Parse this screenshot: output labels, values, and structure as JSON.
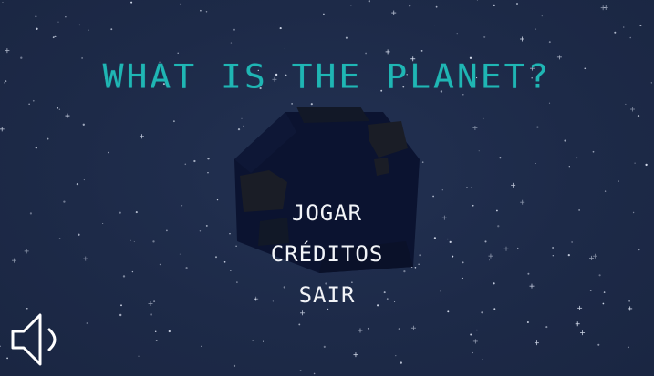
{
  "game": {
    "title": "WHAT IS THE PLANET?",
    "title_color": "#1fb6b4",
    "background_color": "#1d2a48"
  },
  "menu": {
    "items": [
      {
        "label": "JOGAR"
      },
      {
        "label": "CRÉDITOS"
      },
      {
        "label": "SAIR"
      }
    ],
    "text_color": "#f2f4f8"
  },
  "controls": {
    "sound_icon": "speaker-sound-on-icon"
  },
  "scene": {
    "planet_icon": "dark-planet-silhouette",
    "starfield": "white-stars"
  }
}
